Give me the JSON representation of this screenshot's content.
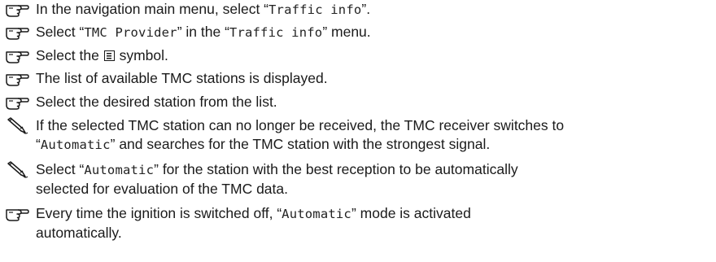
{
  "icons": {
    "action": "pointing-hand-icon",
    "note": "pencil-note-icon"
  },
  "steps": [
    {
      "kind": "action",
      "parts": [
        {
          "t": "In the navigation main menu, select “"
        },
        {
          "t": "Traffic info",
          "mono": true
        },
        {
          "t": "”."
        }
      ]
    },
    {
      "kind": "action",
      "parts": [
        {
          "t": "Select “"
        },
        {
          "t": "TMC Provider",
          "mono": true
        },
        {
          "t": "” in the “"
        },
        {
          "t": "Traffic info",
          "mono": true
        },
        {
          "t": "” menu."
        }
      ]
    },
    {
      "kind": "action",
      "parts": [
        {
          "t": "Select the "
        },
        {
          "icon": "list-symbol-icon"
        },
        {
          "t": " symbol."
        }
      ]
    },
    {
      "kind": "action",
      "parts": [
        {
          "t": "The list of available TMC stations is displayed."
        }
      ]
    },
    {
      "kind": "action",
      "parts": [
        {
          "t": "Select the desired station from the list."
        }
      ]
    },
    {
      "kind": "note",
      "parts": [
        {
          "t": "If the selected TMC station can no longer be received, the TMC receiver switches to\n“"
        },
        {
          "t": "Automatic",
          "mono": true
        },
        {
          "t": "” and searches for the TMC station with the strongest signal."
        }
      ]
    },
    {
      "kind": "note",
      "parts": [
        {
          "t": "Select “"
        },
        {
          "t": "Automatic",
          "mono": true
        },
        {
          "t": "” for the station with the best reception to be automatically\nselected for evaluation of the TMC data."
        }
      ]
    },
    {
      "kind": "action",
      "parts": [
        {
          "t": "Every time the ignition is switched off, “"
        },
        {
          "t": "Automatic",
          "mono": true
        },
        {
          "t": "” mode is activated\nautomatically."
        }
      ]
    }
  ]
}
